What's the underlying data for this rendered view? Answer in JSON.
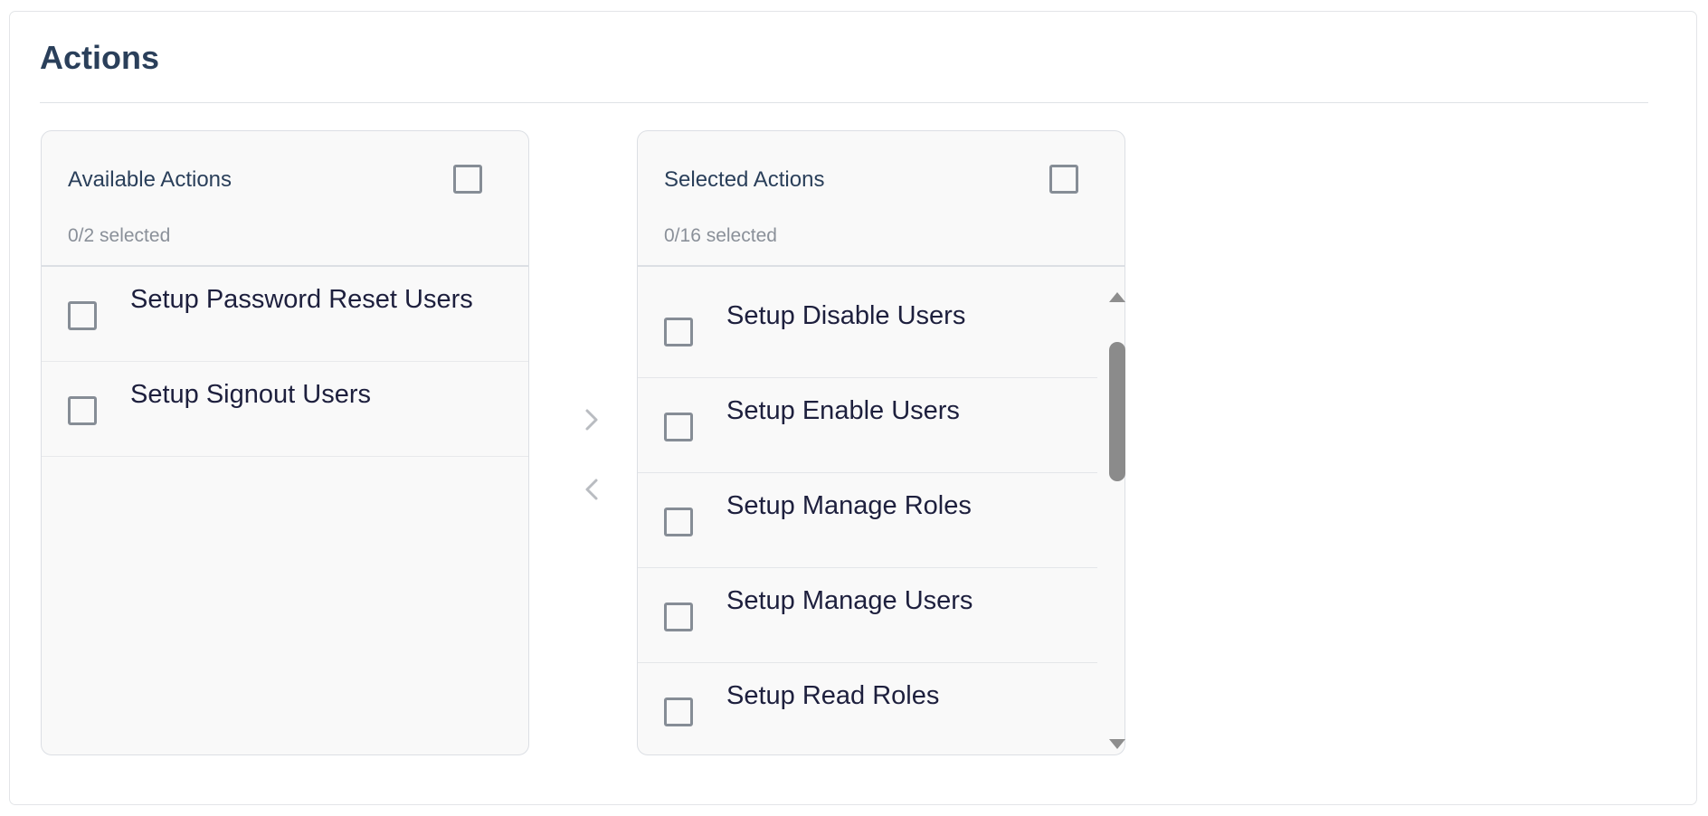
{
  "section": {
    "title": "Actions"
  },
  "available": {
    "title": "Available Actions",
    "count": "0/2 selected",
    "items": [
      {
        "label": "Setup Password Reset Users"
      },
      {
        "label": "Setup Signout Users"
      }
    ]
  },
  "selected": {
    "title": "Selected Actions",
    "count": "0/16 selected",
    "items": [
      {
        "label": "Setup Disable Users"
      },
      {
        "label": "Setup Enable Users"
      },
      {
        "label": "Setup Manage Roles"
      },
      {
        "label": "Setup Manage Users"
      },
      {
        "label": "Setup Read Roles"
      }
    ]
  },
  "controls": {
    "move_right_icon": "chevron-right-icon",
    "move_left_icon": "chevron-left-icon"
  },
  "colors": {
    "title": "#2a3f5a",
    "item_text": "#1d1f3d",
    "muted_text": "#8a9099",
    "checkbox_border": "#868d96",
    "panel_bg": "#f9f9f9",
    "scrollbar": "#8b8b8b"
  }
}
